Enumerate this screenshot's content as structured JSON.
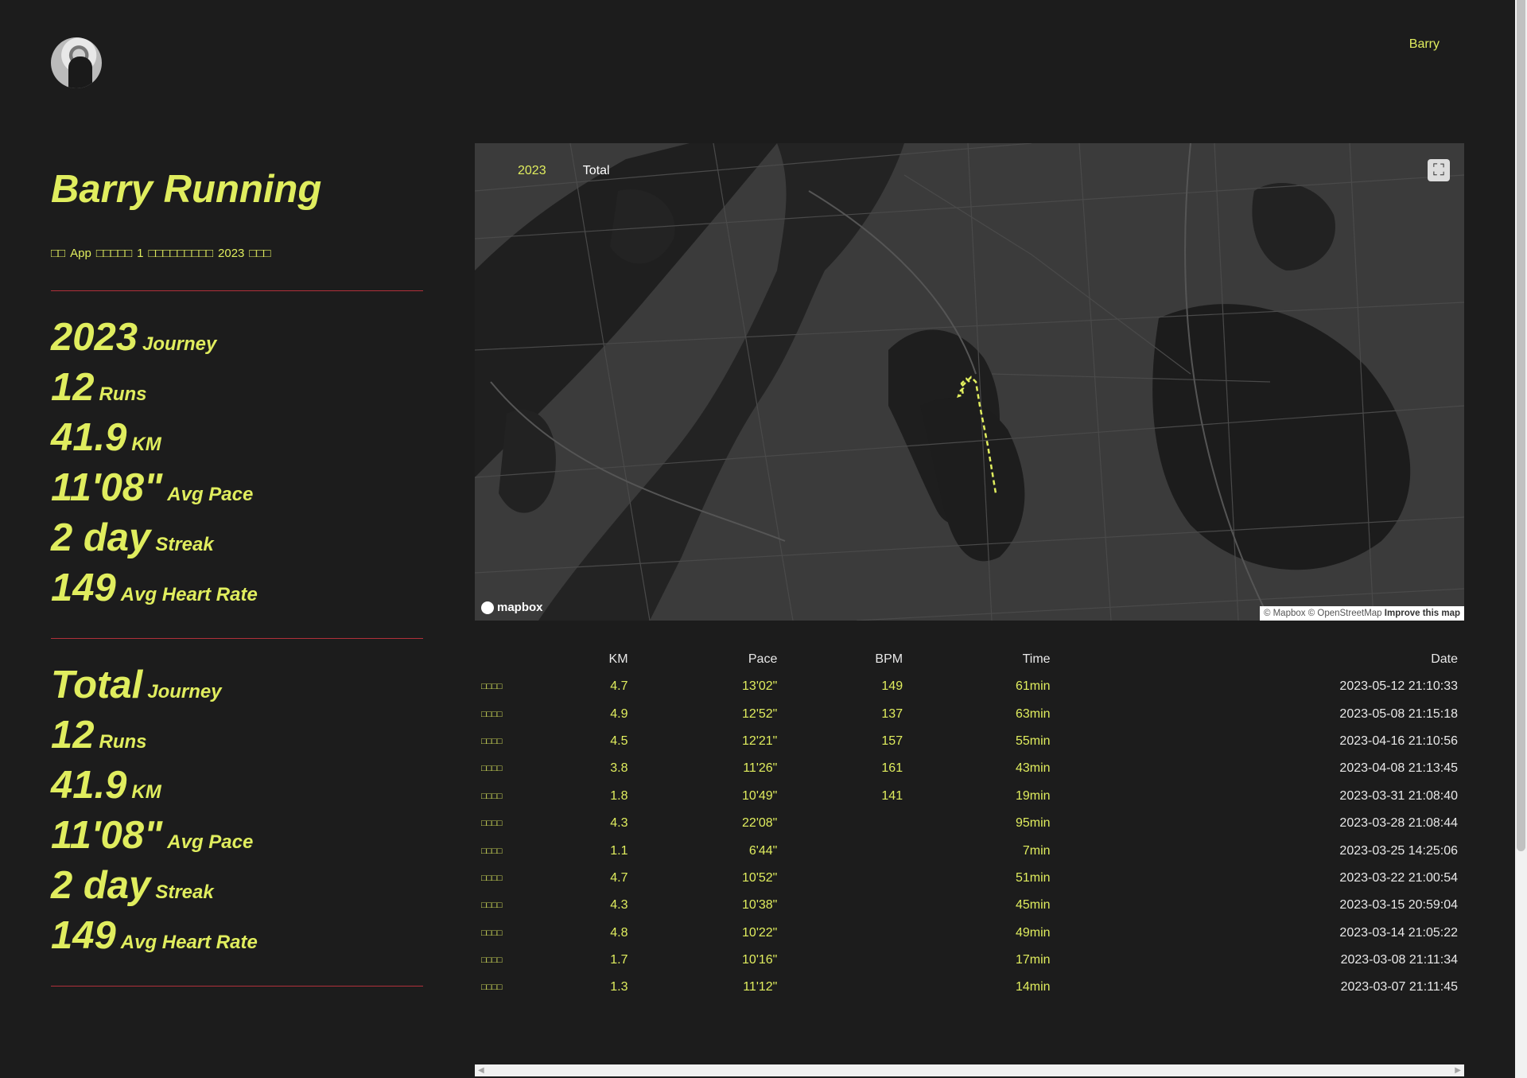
{
  "header": {
    "nav_link": "Barry"
  },
  "site": {
    "title": "Barry Running",
    "intro_parts": [
      "□□",
      "App",
      "□□□□□",
      "1",
      "□□□□□□□□□",
      "2023",
      "□□□"
    ]
  },
  "year_stats": [
    {
      "num": "2023",
      "label": "Journey"
    },
    {
      "num": "12",
      "label": "Runs"
    },
    {
      "num": "41.9",
      "label": "KM"
    },
    {
      "num": "11'08\"",
      "label": "Avg Pace"
    },
    {
      "num": "2 day",
      "label": "Streak"
    },
    {
      "num": "149",
      "label": "Avg Heart Rate"
    }
  ],
  "total_stats": [
    {
      "num": "Total",
      "label": "Journey"
    },
    {
      "num": "12",
      "label": "Runs"
    },
    {
      "num": "41.9",
      "label": "KM"
    },
    {
      "num": "11'08\"",
      "label": "Avg Pace"
    },
    {
      "num": "2 day",
      "label": "Streak"
    },
    {
      "num": "149",
      "label": "Avg Heart Rate"
    }
  ],
  "map": {
    "tabs": [
      "2023",
      "Total"
    ],
    "logo": "mapbox",
    "attribution_prefix": "© Mapbox © OpenStreetMap",
    "attribution_link": "Improve this map",
    "route_color": "#e0ed5e"
  },
  "table": {
    "headers": [
      "",
      "KM",
      "Pace",
      "BPM",
      "Time",
      "Date"
    ],
    "rows": [
      [
        "□□□□",
        "4.7",
        "13'02\"",
        "149",
        "61min",
        "2023-05-12 21:10:33"
      ],
      [
        "□□□□",
        "4.9",
        "12'52\"",
        "137",
        "63min",
        "2023-05-08 21:15:18"
      ],
      [
        "□□□□",
        "4.5",
        "12'21\"",
        "157",
        "55min",
        "2023-04-16 21:10:56"
      ],
      [
        "□□□□",
        "3.8",
        "11'26\"",
        "161",
        "43min",
        "2023-04-08 21:13:45"
      ],
      [
        "□□□□",
        "1.8",
        "10'49\"",
        "141",
        "19min",
        "2023-03-31 21:08:40"
      ],
      [
        "□□□□",
        "4.3",
        "22'08\"",
        "",
        "95min",
        "2023-03-28 21:08:44"
      ],
      [
        "□□□□",
        "1.1",
        "6'44\"",
        "",
        "7min",
        "2023-03-25 14:25:06"
      ],
      [
        "□□□□",
        "4.7",
        "10'52\"",
        "",
        "51min",
        "2023-03-22 21:00:54"
      ],
      [
        "□□□□",
        "4.3",
        "10'38\"",
        "",
        "45min",
        "2023-03-15 20:59:04"
      ],
      [
        "□□□□",
        "4.8",
        "10'22\"",
        "",
        "49min",
        "2023-03-14 21:05:22"
      ],
      [
        "□□□□",
        "1.7",
        "10'16\"",
        "",
        "17min",
        "2023-03-08 21:11:34"
      ],
      [
        "□□□□",
        "1.3",
        "11'12\"",
        "",
        "14min",
        "2023-03-07 21:11:45"
      ]
    ]
  }
}
